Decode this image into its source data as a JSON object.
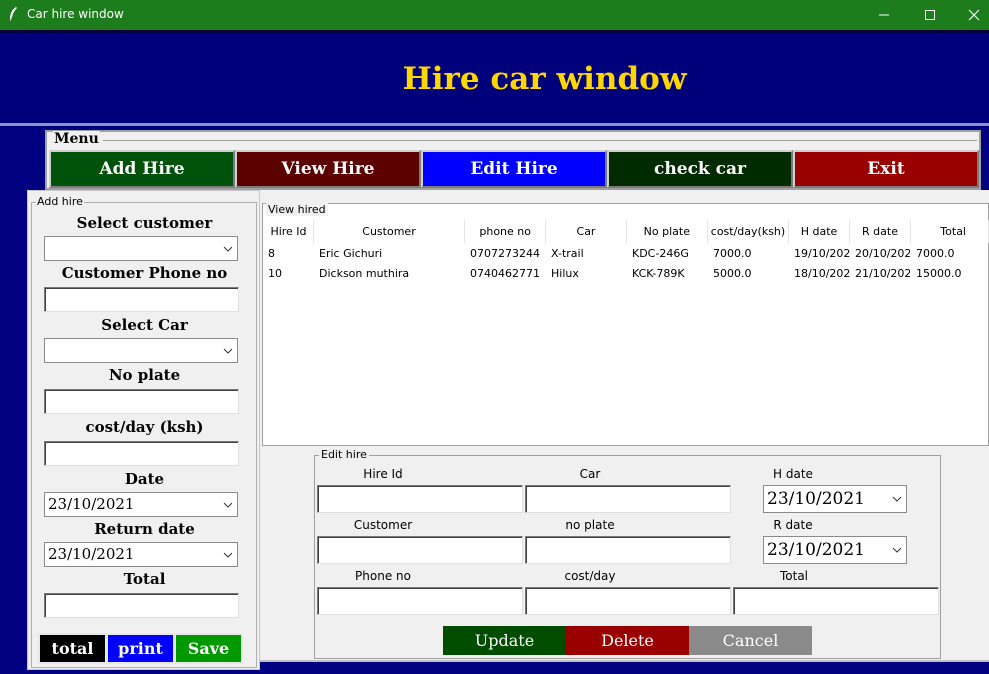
{
  "window": {
    "title": "Car hire window",
    "minimize_glyph": "—",
    "maximize_glyph": "☐",
    "close_glyph": "✕"
  },
  "header": {
    "title": "Hire car window"
  },
  "menu": {
    "legend": "Menu",
    "buttons": [
      {
        "label": "Add Hire",
        "color": "#00520a"
      },
      {
        "label": "View Hire",
        "color": "#5c0000"
      },
      {
        "label": "Edit Hire",
        "color": "#0000ff"
      },
      {
        "label": "check car",
        "color": "#002a00"
      },
      {
        "label": "Exit",
        "color": "#990000"
      }
    ]
  },
  "add_hire": {
    "legend": "Add hire",
    "select_customer_label": "Select customer",
    "select_customer_value": "",
    "phone_label": "Customer Phone no",
    "phone_value": "",
    "select_car_label": "Select Car",
    "select_car_value": "",
    "no_plate_label": "No plate",
    "no_plate_value": "",
    "cost_label": "cost/day (ksh)",
    "cost_value": "",
    "date_label": "Date",
    "date_value": "23/10/2021",
    "return_date_label": "Return date",
    "return_date_value": "23/10/2021",
    "total_label": "Total",
    "total_value": "",
    "buttons": [
      {
        "label": "total",
        "color": "#000000"
      },
      {
        "label": "print",
        "color": "#0000ff"
      },
      {
        "label": "Save",
        "color": "#009900"
      }
    ]
  },
  "view_hired": {
    "legend": "View hired",
    "columns": [
      "Hire Id",
      "Customer",
      "phone no",
      "Car",
      "No plate",
      "cost/day(ksh)",
      "H date",
      "R date",
      "Total"
    ],
    "rows": [
      [
        "8",
        "Eric Gichuri",
        "0707273244",
        "X-trail",
        "KDC-246G",
        "7000.0",
        "19/10/202",
        "20/10/202",
        "7000.0"
      ],
      [
        "10",
        "Dickson muthira",
        "0740462771",
        "Hilux",
        "KCK-789K",
        "5000.0",
        "18/10/202",
        "21/10/202",
        "15000.0"
      ]
    ]
  },
  "edit_hire": {
    "legend": "Edit hire",
    "hire_id_label": "Hire Id",
    "hire_id_value": "",
    "car_label": "Car",
    "car_value": "",
    "h_date_label": "H date",
    "h_date_value": "23/10/2021",
    "customer_label": "Customer",
    "customer_value": "",
    "no_plate_label": "no plate",
    "no_plate_value": "",
    "r_date_label": "R date",
    "r_date_value": "23/10/2021",
    "phone_label": "Phone no",
    "phone_value": "",
    "cost_label": "cost/day",
    "cost_value": "",
    "total_label": "Total",
    "total_value": "",
    "buttons": [
      {
        "label": "Update",
        "color": "#004d00"
      },
      {
        "label": "Delete",
        "color": "#990000"
      },
      {
        "label": "Cancel",
        "color": "#8a8a8a"
      }
    ]
  }
}
